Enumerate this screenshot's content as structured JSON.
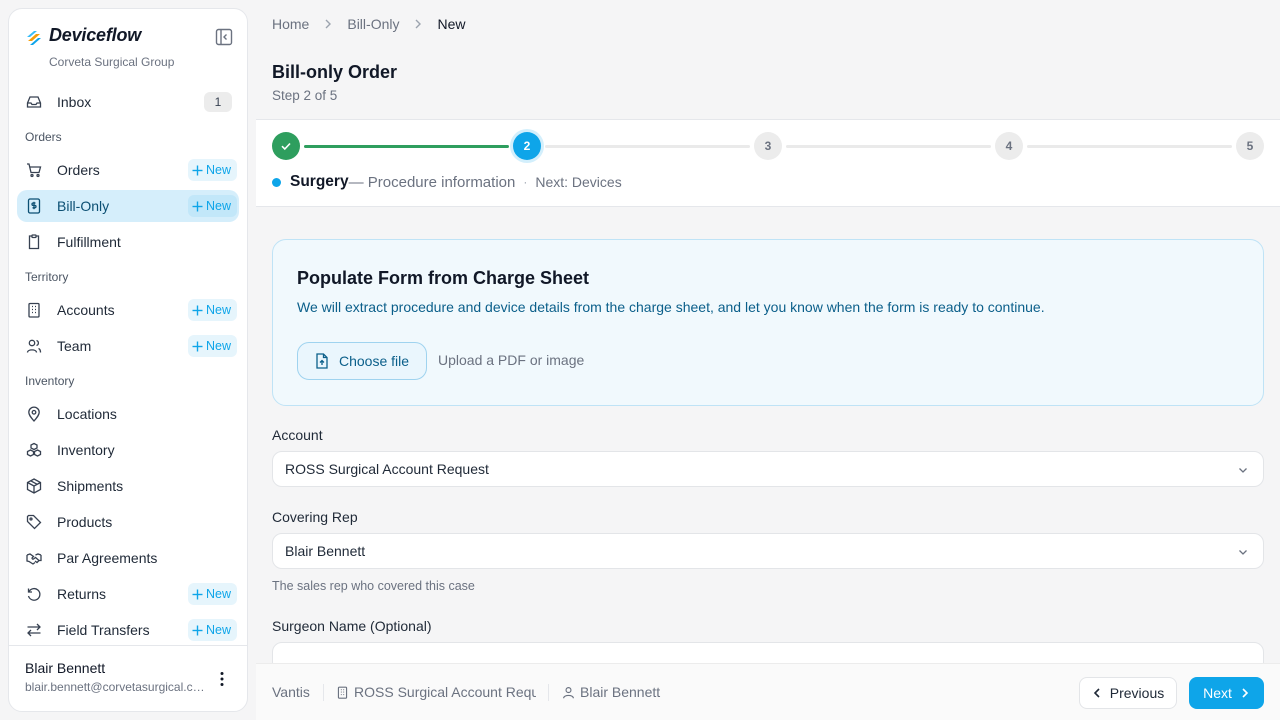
{
  "brand": {
    "name": "Deviceflow",
    "org": "Corveta Surgical Group"
  },
  "nav": {
    "inbox": {
      "label": "Inbox",
      "badge": "1"
    },
    "orders_section": "Orders",
    "orders": {
      "label": "Orders",
      "new": "New"
    },
    "bill_only": {
      "label": "Bill-Only",
      "new": "New"
    },
    "fulfillment": {
      "label": "Fulfillment"
    },
    "territory_section": "Territory",
    "accounts": {
      "label": "Accounts",
      "new": "New"
    },
    "team": {
      "label": "Team",
      "new": "New"
    },
    "inventory_section": "Inventory",
    "locations": {
      "label": "Locations"
    },
    "inventory": {
      "label": "Inventory"
    },
    "shipments": {
      "label": "Shipments"
    },
    "products": {
      "label": "Products"
    },
    "par_agreements": {
      "label": "Par Agreements"
    },
    "returns": {
      "label": "Returns",
      "new": "New"
    },
    "field_transfers": {
      "label": "Field Transfers",
      "new": "New"
    }
  },
  "user": {
    "name": "Blair Bennett",
    "email": "blair.bennett@corvetasurgical.com"
  },
  "breadcrumb": [
    "Home",
    "Bill-Only",
    "New"
  ],
  "page": {
    "title": "Bill-only Order",
    "subtitle": "Step 2 of 5"
  },
  "stepper": {
    "steps": [
      "1",
      "2",
      "3",
      "4",
      "5"
    ],
    "current_step": 2,
    "current_name": "Surgery",
    "current_desc": "— Procedure information",
    "separator": "·",
    "next": "Next: Devices"
  },
  "upload": {
    "title": "Populate Form from Charge Sheet",
    "description": "We will extract procedure and device details from the charge sheet, and let you know when the form is ready to continue.",
    "button": "Choose file",
    "hint": "Upload a PDF or image"
  },
  "form": {
    "account": {
      "label": "Account",
      "value": "ROSS Surgical Account Request"
    },
    "covering_rep": {
      "label": "Covering Rep",
      "value": "Blair Bennett",
      "helper": "The sales rep who covered this case"
    },
    "surgeon": {
      "label": "Surgeon Name (Optional)",
      "value": ""
    }
  },
  "footer": {
    "vendor": "Vantis",
    "account": "ROSS Surgical Account Request",
    "rep": "Blair Bennett",
    "previous": "Previous",
    "next": "Next"
  },
  "colors": {
    "accent": "#0ea5e9",
    "success": "#2e9e5e",
    "active_nav_bg": "#d5eefb"
  }
}
